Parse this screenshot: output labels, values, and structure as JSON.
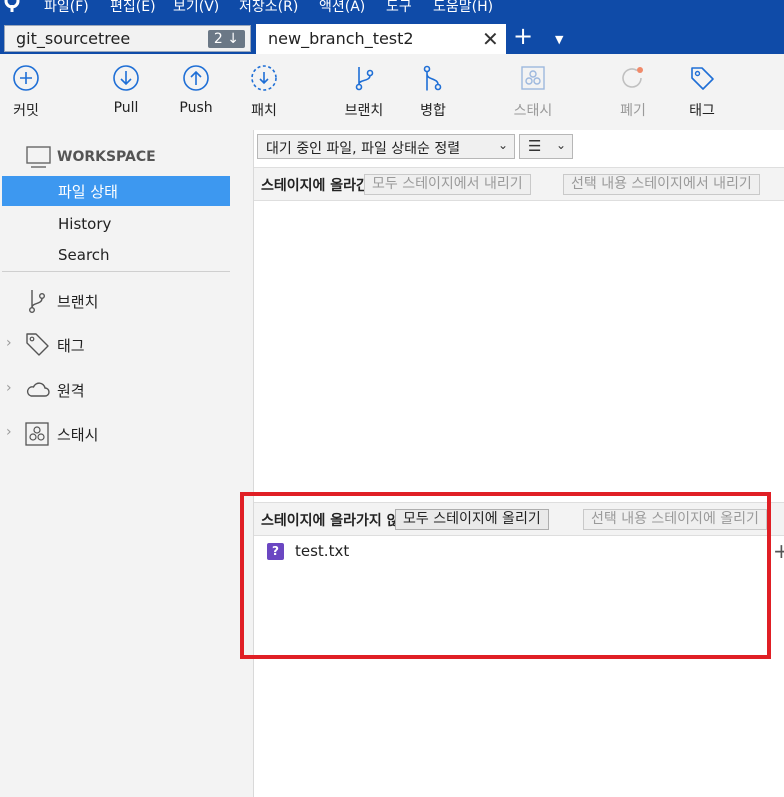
{
  "menu": [
    "파일(F)",
    "편집(E)",
    "보기(V)",
    "저장소(R)",
    "액션(A)",
    "도구",
    "도움말(H)"
  ],
  "tabs": {
    "repo": {
      "name": "git_sourcetree",
      "badge": "2 ↓"
    },
    "branch": {
      "name": "new_branch_test2",
      "close": "✕"
    },
    "new_tab": "+",
    "more": "▼"
  },
  "toolbar": {
    "commit": "커밋",
    "pull": "Pull",
    "push": "Push",
    "patch": "패치",
    "branch": "브랜치",
    "merge": "병합",
    "stash": "스태시",
    "discard": "폐기",
    "tag": "태그"
  },
  "sidebar": {
    "workspace": "WORKSPACE",
    "file_status": "파일 상태",
    "history": "History",
    "search": "Search",
    "branches": "브랜치",
    "tags": "태그",
    "remotes": "원격",
    "stashes": "스태시",
    "chevron": "›"
  },
  "main": {
    "sort_select": "대기 중인 파일, 파일 상태순 정렬",
    "select_arrow": "⌄",
    "view_icon": "☰",
    "staged": {
      "title": "스테이지에 올라간 파일",
      "unstage_all": "모두 스테이지에서 내리기",
      "unstage_selected": "선택 내용 스테이지에서 내리기"
    },
    "unstaged": {
      "title": "스테이지에 올라가지 않은 파일",
      "stage_all": "모두 스테이지에 올리기",
      "stage_selected": "선택 내용 스테이지에 올리기"
    },
    "files": [
      {
        "name": "test.txt",
        "status": "?",
        "action": "+"
      }
    ]
  },
  "colors": {
    "menubar": "#0f4ba8",
    "selection": "#3d98f0",
    "untracked": "#6b47c2",
    "highlight": "#e01f25"
  }
}
